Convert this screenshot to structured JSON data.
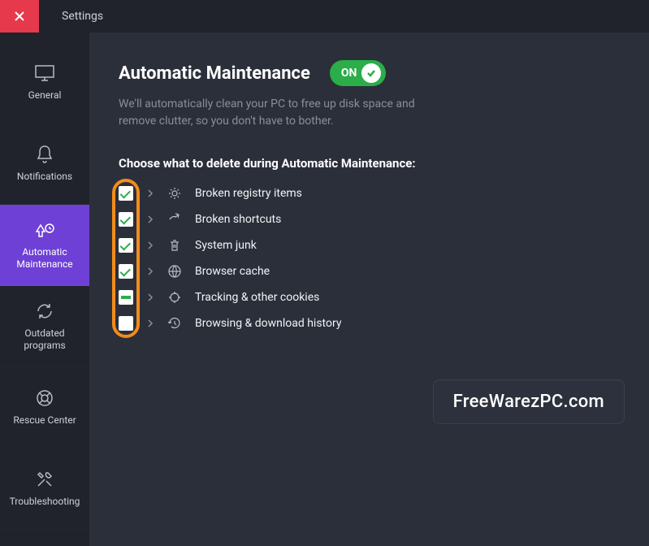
{
  "titlebar": {
    "title": "Settings"
  },
  "sidebar": {
    "items": [
      {
        "label": "General"
      },
      {
        "label": "Notifications"
      },
      {
        "label": "Automatic Maintenance"
      },
      {
        "label": "Outdated programs"
      },
      {
        "label": "Rescue Center"
      },
      {
        "label": "Troubleshooting"
      }
    ]
  },
  "main": {
    "heading": "Automatic Maintenance",
    "toggle_label": "ON",
    "subtext": "We'll automatically clean your PC to free up disk space and remove clutter, so you don't have to bother.",
    "section_label": "Choose what to delete during Automatic Maintenance:",
    "options": [
      {
        "label": "Broken registry items",
        "state": "checked",
        "icon": "registry-icon"
      },
      {
        "label": "Broken shortcuts",
        "state": "checked",
        "icon": "shortcut-icon"
      },
      {
        "label": "System junk",
        "state": "checked",
        "icon": "trash-icon"
      },
      {
        "label": "Browser cache",
        "state": "checked",
        "icon": "globe-icon"
      },
      {
        "label": "Tracking & other cookies",
        "state": "partial",
        "icon": "target-icon"
      },
      {
        "label": "Browsing & download history",
        "state": "unchecked",
        "icon": "history-icon"
      }
    ]
  },
  "watermark": "FreeWarezPC.com",
  "colors": {
    "accent": "#6e40d6",
    "toggle_on": "#2bad4a",
    "highlight": "#f28c1b",
    "close": "#e6394b"
  },
  "highlight_ring_around_checkboxes": true
}
